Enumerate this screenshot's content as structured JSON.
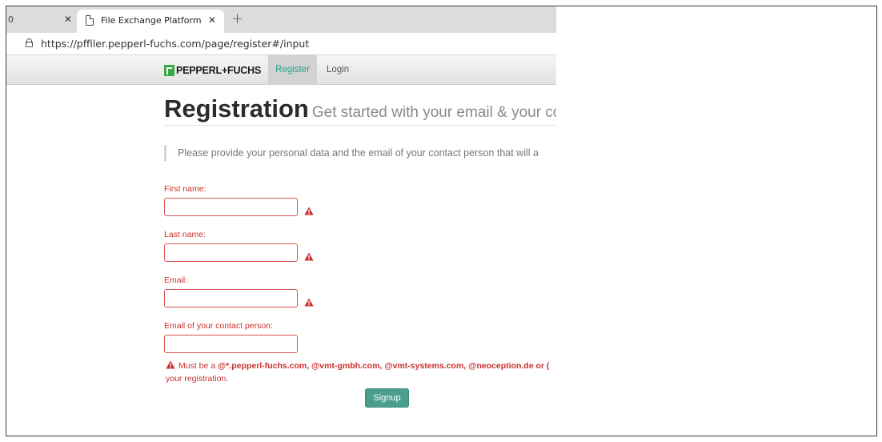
{
  "browser": {
    "prev_tab_fragment": "0",
    "active_tab_title": "File Exchange Platform",
    "url": "https://pffiler.pepperl-fuchs.com/page/register#/input"
  },
  "site": {
    "logo_text": "PEPPERL+FUCHS",
    "nav": {
      "register": "Register",
      "login": "Login"
    },
    "accent_color": "#2aa08a",
    "brand_color": "#3aa845"
  },
  "page": {
    "title": "Registration",
    "subtitle": "Get started with your email & your cor",
    "notice": "Please provide your personal data and the email of your contact person that will a"
  },
  "form": {
    "first_name": {
      "label": "First name:",
      "value": ""
    },
    "last_name": {
      "label": "Last name:",
      "value": ""
    },
    "email": {
      "label": "Email:",
      "value": ""
    },
    "contact_email": {
      "label": "Email of your contact person:",
      "value": ""
    },
    "error": {
      "prefix": "Must be a",
      "domains": "@*.pepperl-fuchs.com, @vmt-gmbh.com, @vmt-systems.com, @neoception.de or (",
      "line2": "your registration."
    },
    "submit_label": "Signup",
    "error_color": "#c9302c"
  }
}
